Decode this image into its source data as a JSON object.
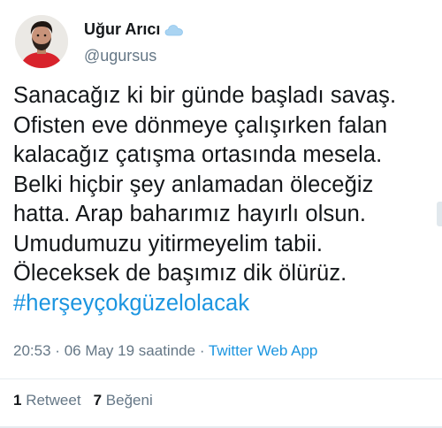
{
  "author": {
    "display_name": "Uğur Arıcı",
    "handle": "@ugursus",
    "badge_icon": "cloud-icon",
    "avatar_icon": "avatar-person-red-shirt"
  },
  "tweet": {
    "lines": [
      "Sanacağız ki bir günde başladı savaş.",
      "Ofisten eve dönmeye çalışırken falan",
      "kalacağız çatışma ortasında mesela.",
      "Belki hiçbir şey anlamadan öleceğiz",
      "hatta. Arap baharımız hayırlı olsun.",
      "Umudumuzu yitirmeyelim tabii.",
      "Öleceksek de başımız dik ölürüz."
    ],
    "hashtag": "#herşeyçokgüzelolacak"
  },
  "meta": {
    "time": "20:53",
    "separator1": "·",
    "date": "06 May 19 saatinde",
    "separator2": "·",
    "source": "Twitter Web App"
  },
  "stats": {
    "retweet_count": "1",
    "retweet_label": "Retweet",
    "like_count": "7",
    "like_label": "Beğeni"
  },
  "colors": {
    "link": "#1b95e0",
    "secondary": "#657786",
    "primary_text": "#14171a"
  }
}
